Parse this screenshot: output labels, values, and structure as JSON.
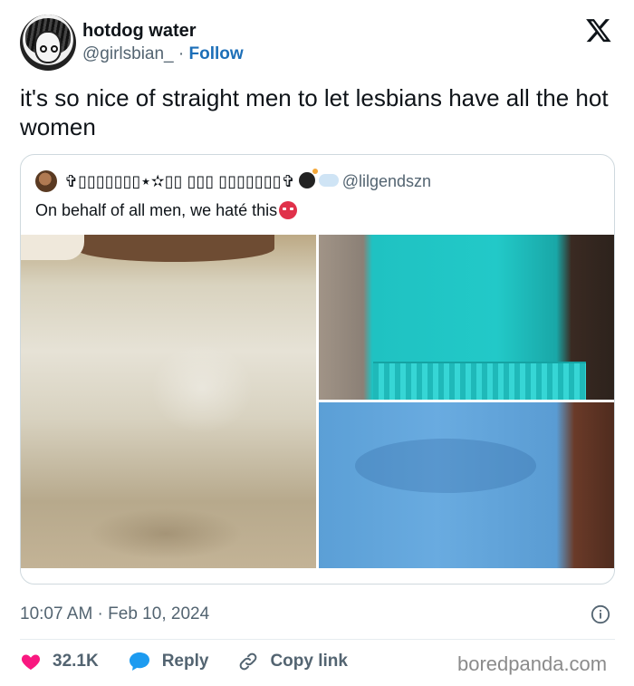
{
  "author": {
    "display_name": "hotdog water",
    "handle": "@girlsbian_",
    "follow_label": "Follow",
    "avatar_icon": "avatar-anime-drawing"
  },
  "brand_icon": "x-logo-icon",
  "tweet_text": "it's so nice of straight men to let lesbians have all the hot women",
  "quoted": {
    "display_name": "✞▯▯▯▯▯▯▯⋆✫▯▯ ▯▯▯ ▯▯▯▯▯▯▯✞",
    "handle": "@lilgendszn",
    "text": "On behalf of all men, we haté this",
    "emoji": [
      "bomb",
      "dash",
      "angry-face"
    ],
    "photos": [
      "beige-bodycon-dress",
      "teal-ruffle-dress",
      "blue-bodycon-dress"
    ]
  },
  "timestamp": "10:07 AM · Feb 10, 2024",
  "actions": {
    "like_count": "32.1K",
    "reply_label": "Reply",
    "copy_label": "Copy link"
  },
  "watermark": "boredpanda.com",
  "colors": {
    "like": "#f91880",
    "reply": "#1d9bf0",
    "follow": "#1d6fb8",
    "muted": "#536471"
  }
}
